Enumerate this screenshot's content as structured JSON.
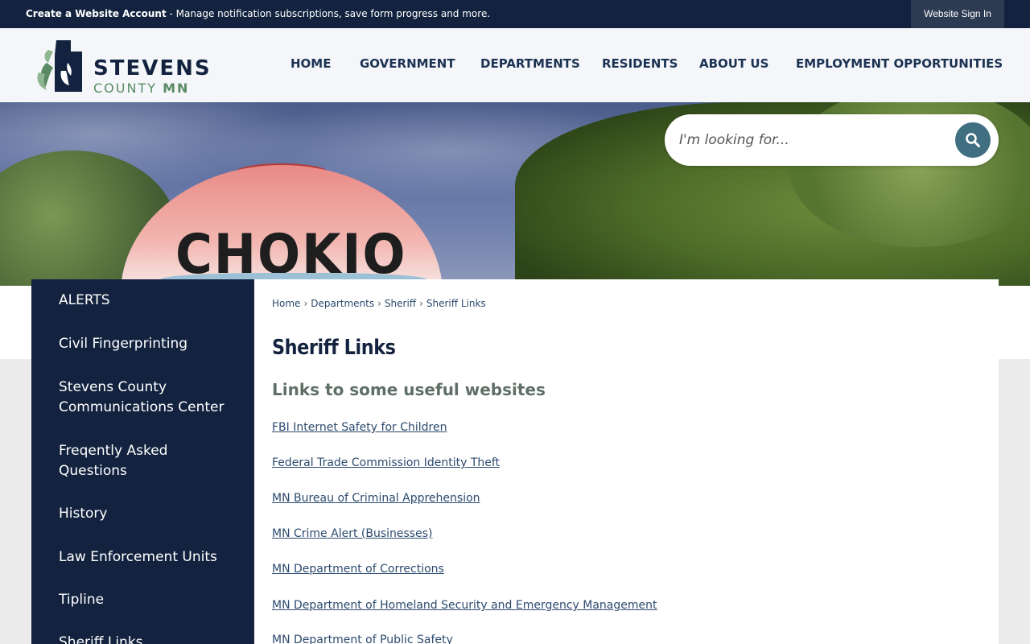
{
  "topbar": {
    "account_link": "Create a Website Account",
    "account_desc": " - Manage notification subscriptions, save form progress and more.",
    "sign_in": "Website Sign In"
  },
  "logo": {
    "name": "STEVENS",
    "county": "COUNTY",
    "state": "MN"
  },
  "nav": {
    "items": [
      {
        "label": "HOME"
      },
      {
        "label": "GOVERNMENT"
      },
      {
        "label": "DEPARTMENTS"
      },
      {
        "label": "RESIDENTS"
      },
      {
        "label": "ABOUT US"
      },
      {
        "label": "EMPLOYMENT OPPORTUNITIES"
      }
    ]
  },
  "hero": {
    "tower_text": "CHOKIO"
  },
  "search": {
    "placeholder": "I'm looking for...",
    "icon": "search-icon"
  },
  "sidebar": {
    "items": [
      {
        "label": "ALERTS"
      },
      {
        "label": "Civil Fingerprinting"
      },
      {
        "label": "Stevens County Communications Center"
      },
      {
        "label": "Freqently Asked Questions"
      },
      {
        "label": "History"
      },
      {
        "label": "Law Enforcement Units"
      },
      {
        "label": "Tipline"
      },
      {
        "label": "Sheriff Links"
      }
    ]
  },
  "breadcrumb": {
    "items": [
      "Home",
      "Departments",
      "Sheriff",
      "Sheriff Links"
    ],
    "separator": "›"
  },
  "main": {
    "title": "Sheriff Links",
    "subtitle": "Links to some useful websites",
    "links": [
      "FBI Internet Safety for Children",
      "Federal Trade Commission Identity Theft",
      "MN Bureau of Criminal Apprehension",
      "MN Crime Alert (Businesses)",
      "MN Department of Corrections",
      "MN Department of Homeland Security and Emergency Management",
      "MN Department of Public Safety"
    ]
  },
  "colors": {
    "navy": "#13233f",
    "accent_teal": "#3f6f80",
    "link": "#2c4a6e",
    "logo_green": "#5a8a63"
  }
}
